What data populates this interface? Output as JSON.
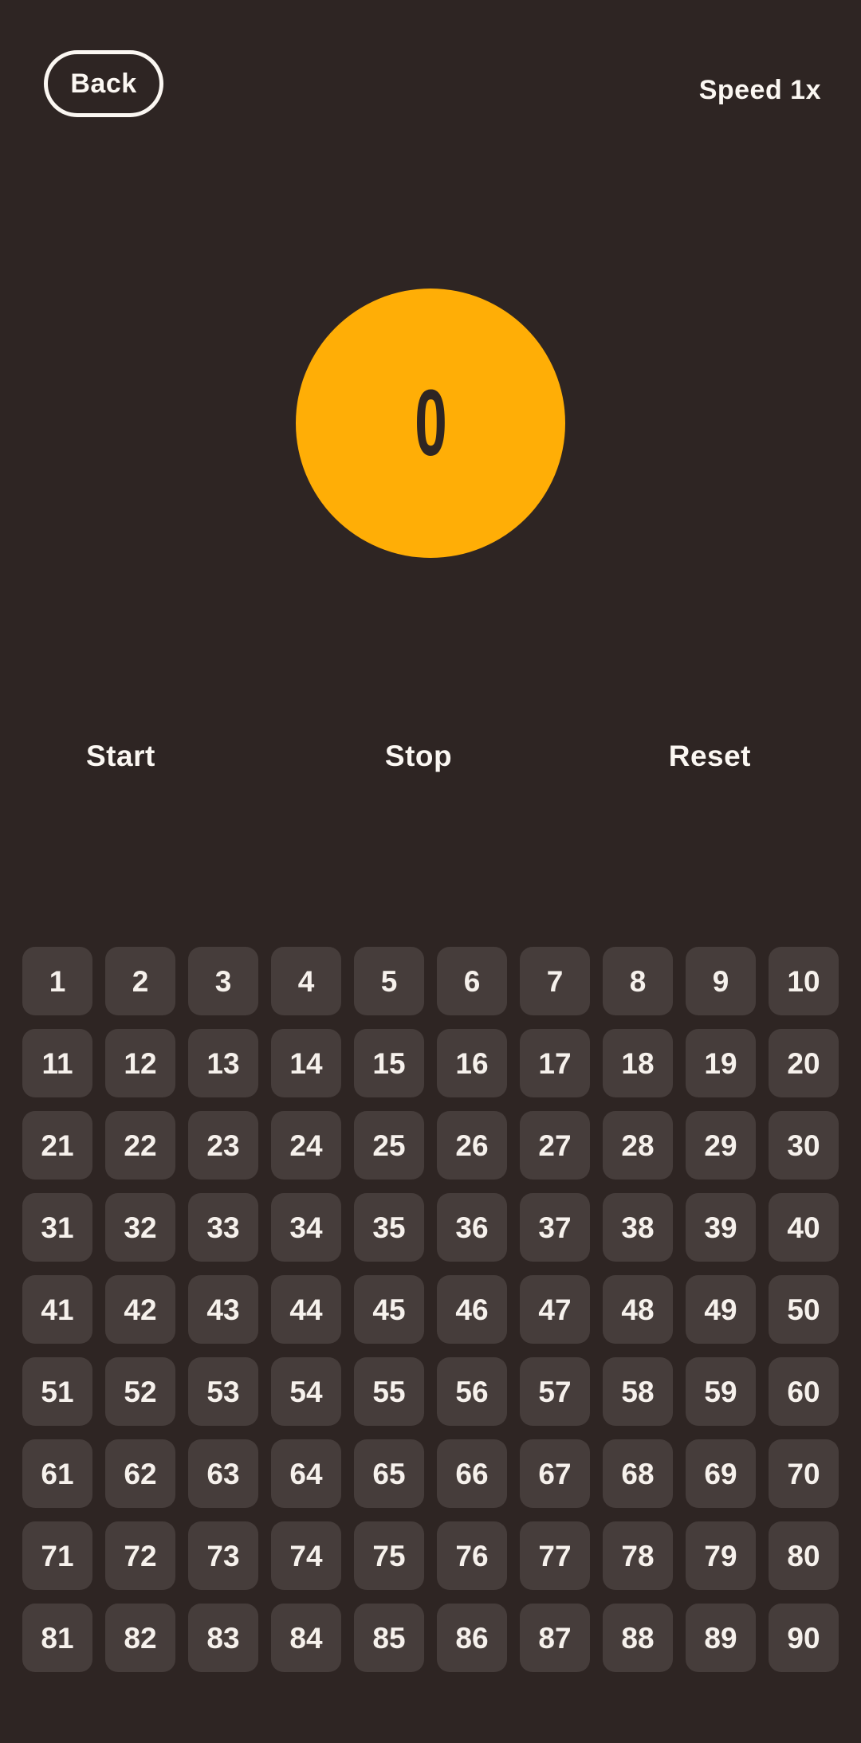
{
  "colors": {
    "background": "#2E2523",
    "accent": "#FFAE06",
    "cell_background": "#463D3B",
    "text": "#FBF7F2"
  },
  "header": {
    "back_label": "Back",
    "speed_label": "Speed 1x"
  },
  "counter": {
    "value": "0"
  },
  "controls": [
    {
      "label": "Start"
    },
    {
      "label": "Stop"
    },
    {
      "label": "Reset"
    }
  ],
  "grid": {
    "columns": 10,
    "rows": 9,
    "cells": [
      "1",
      "2",
      "3",
      "4",
      "5",
      "6",
      "7",
      "8",
      "9",
      "10",
      "11",
      "12",
      "13",
      "14",
      "15",
      "16",
      "17",
      "18",
      "19",
      "20",
      "21",
      "22",
      "23",
      "24",
      "25",
      "26",
      "27",
      "28",
      "29",
      "30",
      "31",
      "32",
      "33",
      "34",
      "35",
      "36",
      "37",
      "38",
      "39",
      "40",
      "41",
      "42",
      "43",
      "44",
      "45",
      "46",
      "47",
      "48",
      "49",
      "50",
      "51",
      "52",
      "53",
      "54",
      "55",
      "56",
      "57",
      "58",
      "59",
      "60",
      "61",
      "62",
      "63",
      "64",
      "65",
      "66",
      "67",
      "68",
      "69",
      "70",
      "71",
      "72",
      "73",
      "74",
      "75",
      "76",
      "77",
      "78",
      "79",
      "80",
      "81",
      "82",
      "83",
      "84",
      "85",
      "86",
      "87",
      "88",
      "89",
      "90"
    ]
  }
}
